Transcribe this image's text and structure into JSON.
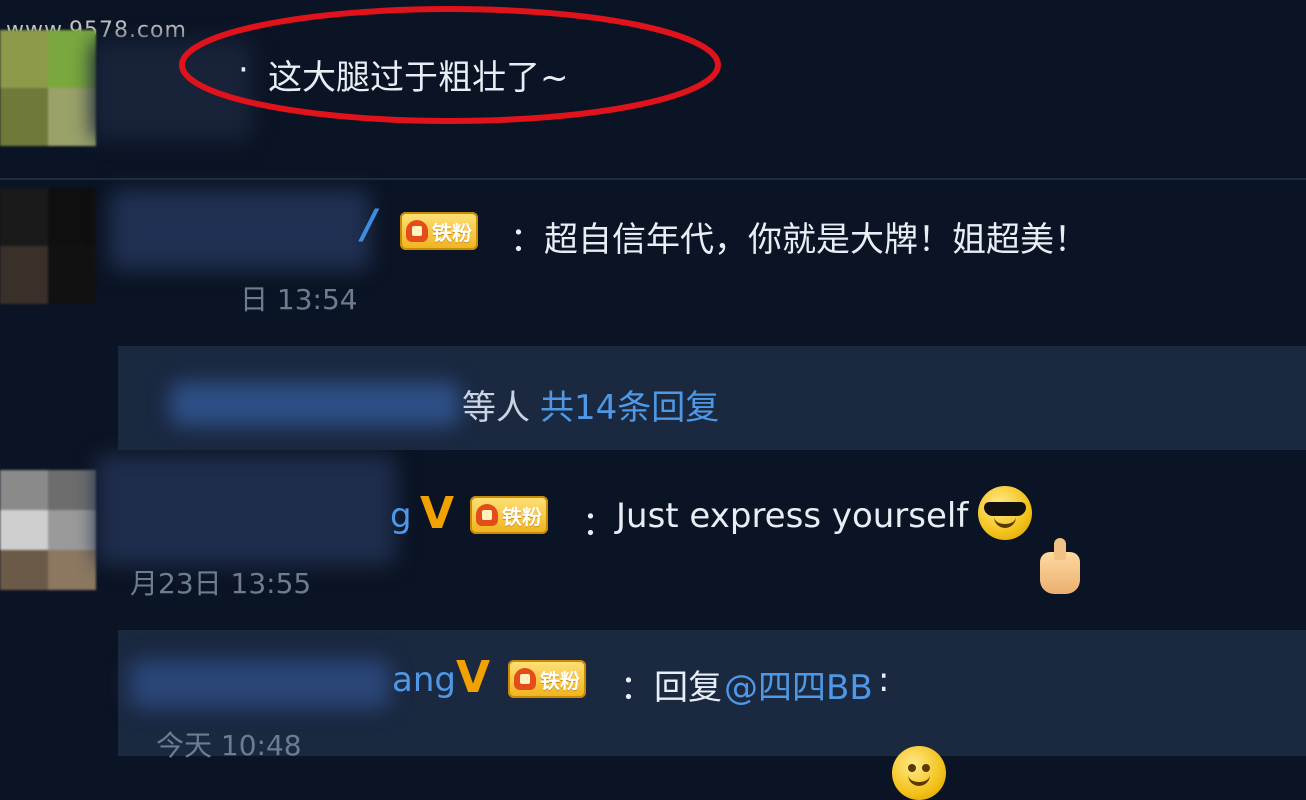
{
  "watermark": "www.9578.com",
  "comment1": {
    "text": "这大腿过于粗壮了~"
  },
  "comment2": {
    "text": "超自信年代，你就是大牌！姐超美！",
    "time_fragment": "日 13:54"
  },
  "reply_summary": {
    "prefix": "等人",
    "link": "共14条回复"
  },
  "comment3": {
    "name_fragment": "g",
    "colon": "：",
    "text": "Just express yourself !",
    "time": "月23日 13:55"
  },
  "reply": {
    "name_fragment": "ang",
    "colon": "：",
    "text_prefix": "回复",
    "mention": "@四四BB",
    "text_suffix": ":",
    "time": "今天 10:48"
  },
  "badge_text": "铁粉",
  "colors": {
    "background": "#0b1424",
    "panel": "#1a2840",
    "link": "#4f98e6",
    "vip_gold": "#f1a200",
    "highlight_circle": "#e0121b"
  },
  "icons": [
    "verified-v-icon",
    "fan-badge-icon",
    "cool-smiley-icon",
    "thumbs-up-icon",
    "smiley-icon"
  ]
}
